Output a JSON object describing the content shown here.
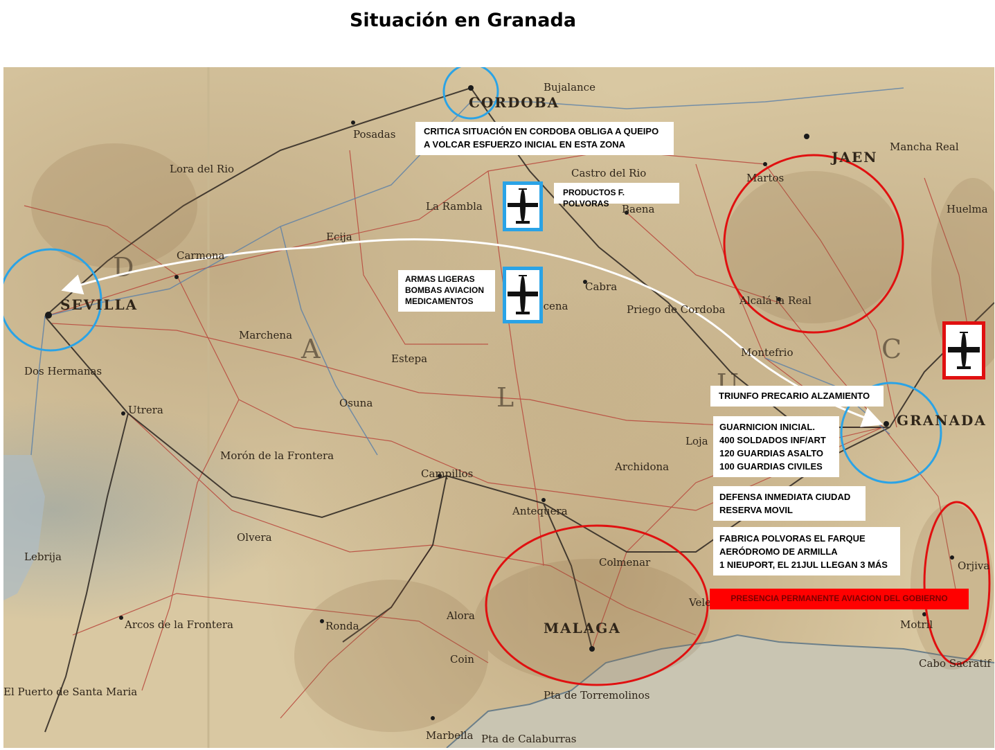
{
  "title": "Situación en Granada",
  "map": {
    "places": [
      {
        "name": "CORDOBA",
        "size": "big"
      },
      {
        "name": "SEVILLA",
        "size": "big"
      },
      {
        "name": "GRANADA",
        "size": "big"
      },
      {
        "name": "MALAGA",
        "size": "big"
      },
      {
        "name": "JAEN",
        "size": "big"
      },
      {
        "name": "Bujalance",
        "size": "med"
      },
      {
        "name": "Posadas",
        "size": "med"
      },
      {
        "name": "Lora del Rio",
        "size": "med"
      },
      {
        "name": "Castro del Rio",
        "size": "med"
      },
      {
        "name": "La Rambla",
        "size": "med"
      },
      {
        "name": "Baena",
        "size": "med"
      },
      {
        "name": "Martos",
        "size": "med"
      },
      {
        "name": "Mancha Real",
        "size": "med"
      },
      {
        "name": "Huelma",
        "size": "med"
      },
      {
        "name": "Ecija",
        "size": "med"
      },
      {
        "name": "Carmona",
        "size": "med"
      },
      {
        "name": "Cabra",
        "size": "med"
      },
      {
        "name": "Priego de Cordoba",
        "size": "med"
      },
      {
        "name": "Alcalá la Real",
        "size": "med"
      },
      {
        "name": "Marchena",
        "size": "med"
      },
      {
        "name": "Estepa",
        "size": "med"
      },
      {
        "name": "Osuna",
        "size": "med"
      },
      {
        "name": "Utrera",
        "size": "med"
      },
      {
        "name": "Lucena",
        "size": "med"
      },
      {
        "name": "Montefrio",
        "size": "med"
      },
      {
        "name": "Loja",
        "size": "med"
      },
      {
        "name": "Archidona",
        "size": "med"
      },
      {
        "name": "Antequera",
        "size": "med"
      },
      {
        "name": "Campillos",
        "size": "med"
      },
      {
        "name": "Morón de la Frontera",
        "size": "med"
      },
      {
        "name": "Olvera",
        "size": "med"
      },
      {
        "name": "Ronda",
        "size": "med"
      },
      {
        "name": "Alora",
        "size": "med"
      },
      {
        "name": "Colmenar",
        "size": "med"
      },
      {
        "name": "Coin",
        "size": "med"
      },
      {
        "name": "Marbella",
        "size": "med"
      },
      {
        "name": "Arcos de la Frontera",
        "size": "med"
      },
      {
        "name": "Motril",
        "size": "med"
      },
      {
        "name": "Orjiva",
        "size": "med"
      },
      {
        "name": "Velez",
        "size": "med"
      },
      {
        "name": "Lebrija",
        "size": "med"
      },
      {
        "name": "Dos Hermanas",
        "size": "med"
      },
      {
        "name": "El Puerto de Santa Maria",
        "size": "med"
      },
      {
        "name": "Cabo Sacratif",
        "size": "med"
      },
      {
        "name": "Pta de Torremolinos",
        "size": "med"
      },
      {
        "name": "Pta de Calaburras",
        "size": "med"
      }
    ]
  },
  "callouts": {
    "cordoba": [
      "CRITICA SITUACIÓN EN CORDOBA OBLIGA A QUEIPO",
      "A VOLCAR ESFUERZO INICIAL EN ESTA ZONA"
    ],
    "polvoras": "PRODUCTOS F. POLVORAS",
    "armas": [
      "ARMAS LIGERAS",
      "BOMBAS AVIACION",
      "MEDICAMENTOS"
    ],
    "triunfo": "TRIUNFO PRECARIO ALZAMIENTO",
    "guarnicion": [
      "GUARNICION INICIAL.",
      "400 SOLDADOS INF/ART",
      "120 GUARDIAS ASALTO",
      "100 GUARDIAS CIVILES"
    ],
    "defensa": [
      "DEFENSA INMEDIATA CIUDAD",
      "RESERVA MOVIL"
    ],
    "fabrica": [
      "FABRICA POLVORAS EL FARQUE",
      "AERÓDROMO DE ARMILLA",
      "1 NIEUPORT, EL 21JUL LLEGAN 3 MÁS"
    ],
    "presencia": "PRESENCIA PERMANENTE AVIACION DEL GOBIERNO"
  },
  "icons": {
    "plane": "airplane-icon",
    "nationalist_color": "#2aa3e6",
    "government_color": "#e01010",
    "arrow_color": "#ffffff"
  }
}
